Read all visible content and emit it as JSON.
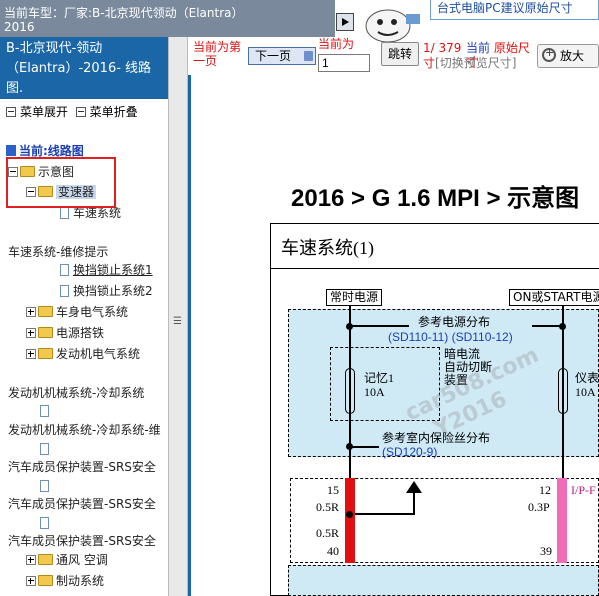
{
  "header": {
    "vehicle_label": "当前车型：",
    "vehicle_value": "厂家:B-北京现代领动（Elantra）2016",
    "banner_text": "台式电脑PC建议原始尺寸"
  },
  "left_panel": {
    "title": "B-北京现代-领动（Elantra）-2016- 线路图.",
    "expand_label": "菜单展开",
    "collapse_label": "菜单折叠",
    "current_label": "当前:线路图"
  },
  "tree": {
    "items": [
      {
        "label": "示意图"
      },
      {
        "label": "变速器"
      },
      {
        "label": "车速系统"
      },
      {
        "label": "车速系统-维修提示"
      },
      {
        "label": "换挡锁止系统1"
      },
      {
        "label": "换挡锁止系统2"
      },
      {
        "label": "车身电气系统"
      },
      {
        "label": "电源搭铁"
      },
      {
        "label": "发动机电气系统"
      },
      {
        "label": "发动机机械系统-冷却系统"
      },
      {
        "label": "发动机机械系统-冷却系统-维"
      },
      {
        "label": "汽车成员保护装置-SRS安全"
      },
      {
        "label": "汽车成员保护装置-SRS安全"
      },
      {
        "label": "汽车成员保护装置-SRS安全"
      },
      {
        "label": "通风 空调"
      },
      {
        "label": "制动系统"
      }
    ]
  },
  "toolbar": {
    "first_page": "当前为第一页",
    "next_page": "下一页",
    "current_label": "当前为",
    "page_value": "1",
    "jump": "跳转",
    "total": "1/ 379",
    "current_size_prefix": "当前",
    "current_size": "原始尺寸",
    "switch_hint": "[切换预览尺寸]",
    "zoom": "放大"
  },
  "document": {
    "heading": "2016 > G 1.6 MPI > 示意图",
    "diagram_title": "车速系统(1)",
    "labels": {
      "always_power": "常时电源",
      "on_start": "ON或START电源",
      "ref_power": "参考电源分布",
      "ref_power_codes": "(SD110-11) (SD110-12)",
      "dark_current_1": "暗电流",
      "dark_current_2": "自动切断",
      "dark_current_3": "装置",
      "memory_fuse": "记忆1",
      "memory_amp": "10A",
      "instrument_fuse": "仪表",
      "instrument_amp": "10A",
      "ref_fuse": "参考室内保险丝分布",
      "ref_fuse_code": "(SD120-9)",
      "pin_15": "15",
      "pin_05r_1": "0.5R",
      "pin_05r_2": "0.5R",
      "pin_40": "40",
      "pin_12": "12",
      "pin_ip": "I/P-F",
      "pin_03p": "0.3P",
      "pin_39": "39"
    },
    "watermark_1": "car508.com",
    "watermark_2": "Y2016"
  }
}
